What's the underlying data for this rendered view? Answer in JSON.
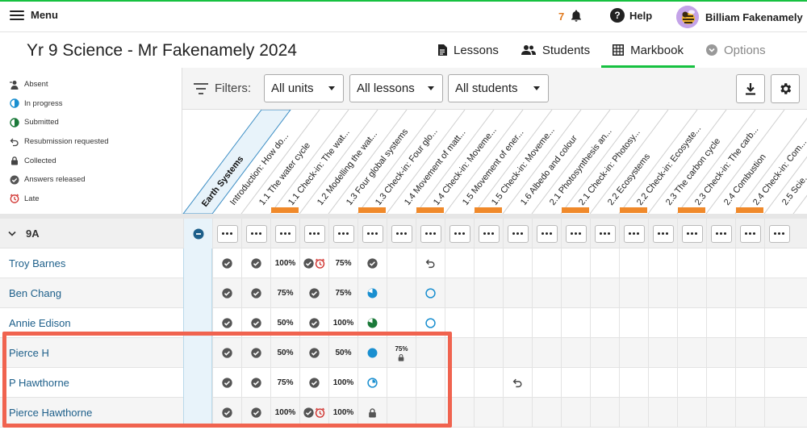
{
  "topbar": {
    "menu_label": "Menu",
    "notification_count": "7",
    "help_label": "Help",
    "user_name": "Billiam Fakenamely"
  },
  "header": {
    "title": "Yr 9 Science - Mr Fakenamely 2024",
    "tabs": [
      {
        "label": "Lessons",
        "icon": "document-icon",
        "state": "normal"
      },
      {
        "label": "Students",
        "icon": "people-icon",
        "state": "normal"
      },
      {
        "label": "Markbook",
        "icon": "grid-icon",
        "state": "active"
      },
      {
        "label": "Options",
        "icon": "chevron-circle-icon",
        "state": "disabled"
      }
    ]
  },
  "legend": [
    {
      "label": "Absent",
      "icon": "absent-icon"
    },
    {
      "label": "In progress",
      "icon": "half-circle-icon"
    },
    {
      "label": "Submitted",
      "icon": "submitted-icon"
    },
    {
      "label": "Resubmission requested",
      "icon": "undo-icon"
    },
    {
      "label": "Collected",
      "icon": "lock-icon"
    },
    {
      "label": "Answers released",
      "icon": "check-circle-icon"
    },
    {
      "label": "Late",
      "icon": "clock-icon"
    }
  ],
  "filters": {
    "label": "Filters:",
    "units": "All units",
    "lessons": "All lessons",
    "students": "All students"
  },
  "unit_header": "Earth Systems",
  "columns": [
    "Introduction: How do...",
    "1.1 The water cycle",
    "1.1 Check-in: The wat...",
    "1.2 Modelling the wat...",
    "1.3 Four global systems",
    "1.3 Check-in: Four glo...",
    "1.4 Movement of matt...",
    "1.4 Check-in: Moveme...",
    "1.5 Movement of ener...",
    "1.5 Check-in: Moveme...",
    "1.6 Albedo and colour",
    "2.1 Photosynthesis an...",
    "2.1 Check-in: Photosy...",
    "2.2 Ecosystems",
    "2.2 Check-in: Ecosyste...",
    "2.3 The carbon cycle",
    "2.3 Check-in: The carb...",
    "2.4 Combustion",
    "2.4 Check-in: Com...",
    "2.5 Scie..."
  ],
  "orange_marker_columns": [
    2,
    5,
    7,
    9,
    12,
    14,
    16,
    18
  ],
  "group": {
    "label": "9A"
  },
  "students": [
    {
      "name": "Troy Barnes",
      "cells": [
        "check",
        "check",
        "100%",
        "check+late",
        "75%",
        "check",
        "",
        "undo"
      ]
    },
    {
      "name": "Ben Chang",
      "cells": [
        "check",
        "check",
        "75%",
        "check",
        "75%",
        "progress-blue",
        "",
        "circle-outline"
      ]
    },
    {
      "name": "Annie Edison",
      "cells": [
        "check",
        "check",
        "50%",
        "check",
        "100%",
        "progress-green",
        "",
        "circle-outline"
      ]
    },
    {
      "name": "Pierce H",
      "cells": [
        "check",
        "check",
        "50%",
        "check",
        "50%",
        "dot-blue",
        "75%+lock",
        ""
      ]
    },
    {
      "name": "P Hawthorne",
      "cells": [
        "check",
        "check",
        "75%",
        "check",
        "100%",
        "progress-small",
        "",
        "",
        "",
        "",
        "undo"
      ]
    },
    {
      "name": "Pierce Hawthorne",
      "cells": [
        "check",
        "check",
        "100%",
        "check+late",
        "100%",
        "lock",
        "",
        ""
      ]
    }
  ],
  "colors": {
    "accent_green": "#16c140",
    "link_blue": "#1d5f8a",
    "highlight": "#f0634f",
    "orange": "#f0892a",
    "progress_blue": "#1a8fd0",
    "progress_green": "#1b7a3a",
    "late_red": "#d0312d"
  }
}
